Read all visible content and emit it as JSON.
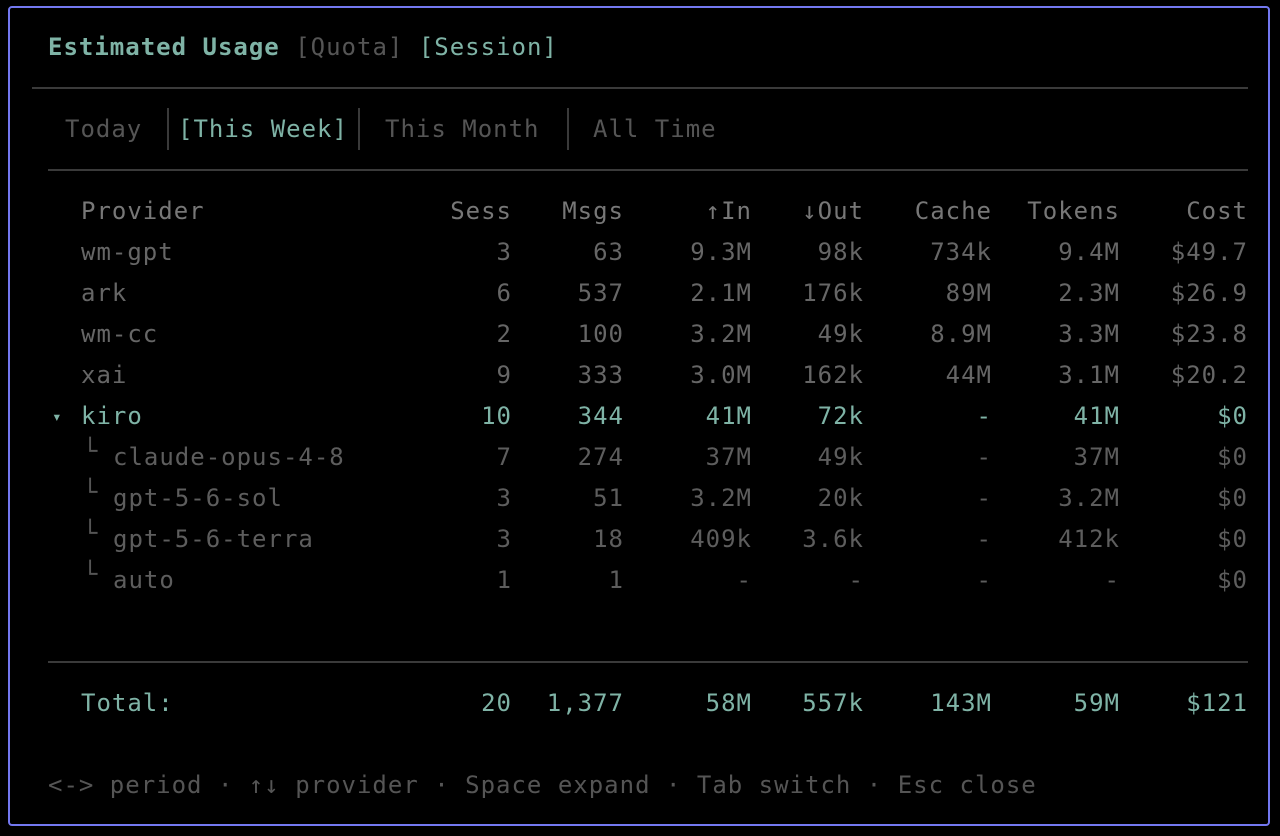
{
  "header": {
    "title": "Estimated Usage",
    "tab_quota": "[Quota]",
    "tab_session": "[Session]"
  },
  "periods": [
    {
      "label": "Today",
      "active": false
    },
    {
      "label": "[This Week]",
      "active": true
    },
    {
      "label": "This Month",
      "active": false
    },
    {
      "label": "All Time",
      "active": false
    }
  ],
  "columns": [
    "Provider",
    "Sess",
    "Msgs",
    "↑In",
    "↓Out",
    "Cache",
    "Tokens",
    "Cost"
  ],
  "rows": [
    {
      "provider": "wm-gpt",
      "sess": "3",
      "msgs": "63",
      "in": "9.3M",
      "out": "98k",
      "cache": "734k",
      "tokens": "9.4M",
      "cost": "$49.7"
    },
    {
      "provider": "ark",
      "sess": "6",
      "msgs": "537",
      "in": "2.1M",
      "out": "176k",
      "cache": "89M",
      "tokens": "2.3M",
      "cost": "$26.9"
    },
    {
      "provider": "wm-cc",
      "sess": "2",
      "msgs": "100",
      "in": "3.2M",
      "out": "49k",
      "cache": "8.9M",
      "tokens": "3.3M",
      "cost": "$23.8"
    },
    {
      "provider": "xai",
      "sess": "9",
      "msgs": "333",
      "in": "3.0M",
      "out": "162k",
      "cache": "44M",
      "tokens": "3.1M",
      "cost": "$20.2"
    },
    {
      "provider": "kiro",
      "sess": "10",
      "msgs": "344",
      "in": "41M",
      "out": "72k",
      "cache": "-",
      "tokens": "41M",
      "cost": "$0",
      "expanded": true,
      "marker": "▾"
    },
    {
      "provider": "claude-opus-4-8",
      "sess": "7",
      "msgs": "274",
      "in": "37M",
      "out": "49k",
      "cache": "-",
      "tokens": "37M",
      "cost": "$0",
      "child": true,
      "branch": "└"
    },
    {
      "provider": "gpt-5-6-sol",
      "sess": "3",
      "msgs": "51",
      "in": "3.2M",
      "out": "20k",
      "cache": "-",
      "tokens": "3.2M",
      "cost": "$0",
      "child": true,
      "branch": "└"
    },
    {
      "provider": "gpt-5-6-terra",
      "sess": "3",
      "msgs": "18",
      "in": "409k",
      "out": "3.6k",
      "cache": "-",
      "tokens": "412k",
      "cost": "$0",
      "child": true,
      "branch": "└"
    },
    {
      "provider": "auto",
      "sess": "1",
      "msgs": "1",
      "in": "-",
      "out": "-",
      "cache": "-",
      "tokens": "-",
      "cost": "$0",
      "child": true,
      "branch": "└"
    }
  ],
  "total": {
    "provider": "Total:",
    "sess": "20",
    "msgs": "1,377",
    "in": "58M",
    "out": "557k",
    "cache": "143M",
    "tokens": "59M",
    "cost": "$121"
  },
  "footer": "<-> period · ↑↓ provider · Space expand · Tab switch · Esc close",
  "colors": {
    "accent": "#7fb3a6",
    "border": "#7378f0",
    "dim": "#555555"
  }
}
